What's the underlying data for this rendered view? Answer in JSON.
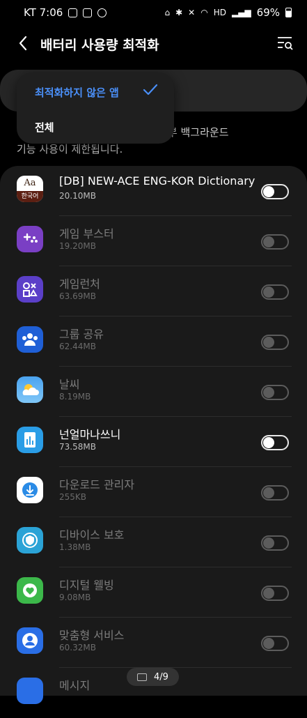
{
  "status": {
    "carrier_time": "KT 7:06",
    "battery": "69%",
    "network": "HD"
  },
  "header": {
    "title": "배터리 사용량 최적화",
    "back_icon": "back-arrow-icon",
    "filter_icon": "filter-search-icon"
  },
  "dropdown": {
    "selected": "최적화하지 않은 앱",
    "other": "전체",
    "accent": "#4a8ff8"
  },
  "description": {
    "line1": "니다. 일부 백그라운드",
    "line2": "기능 사용이 제한됩니다."
  },
  "apps": [
    {
      "name": "[DB] NEW-ACE ENG-KOR Dictionary",
      "size": "20.10MB",
      "enabled": true,
      "icon": "dictionary-icon",
      "icon_text_top": "Aa",
      "icon_text_bottom": "한국어"
    },
    {
      "name": "게임 부스터",
      "size": "19.20MB",
      "enabled": false,
      "icon": "game-booster-icon"
    },
    {
      "name": "게임런처",
      "size": "63.69MB",
      "enabled": false,
      "icon": "game-launcher-icon"
    },
    {
      "name": "그룹 공유",
      "size": "62.44MB",
      "enabled": false,
      "icon": "group-share-icon"
    },
    {
      "name": "날씨",
      "size": "8.19MB",
      "enabled": false,
      "icon": "weather-icon"
    },
    {
      "name": "넌얼마나쓰니",
      "size": "73.58MB",
      "enabled": true,
      "icon": "usage-stats-icon"
    },
    {
      "name": "다운로드 관리자",
      "size": "255KB",
      "enabled": false,
      "icon": "download-manager-icon"
    },
    {
      "name": "디바이스 보호",
      "size": "1.38MB",
      "enabled": false,
      "icon": "device-protection-icon"
    },
    {
      "name": "디지털 웰빙",
      "size": "9.08MB",
      "enabled": false,
      "icon": "digital-wellbeing-icon"
    },
    {
      "name": "맞춤형 서비스",
      "size": "60.32MB",
      "enabled": false,
      "icon": "customization-service-icon"
    },
    {
      "name": "메시지",
      "size": "",
      "enabled": false,
      "icon": "messages-icon"
    }
  ],
  "pager": {
    "label": "4/9"
  }
}
